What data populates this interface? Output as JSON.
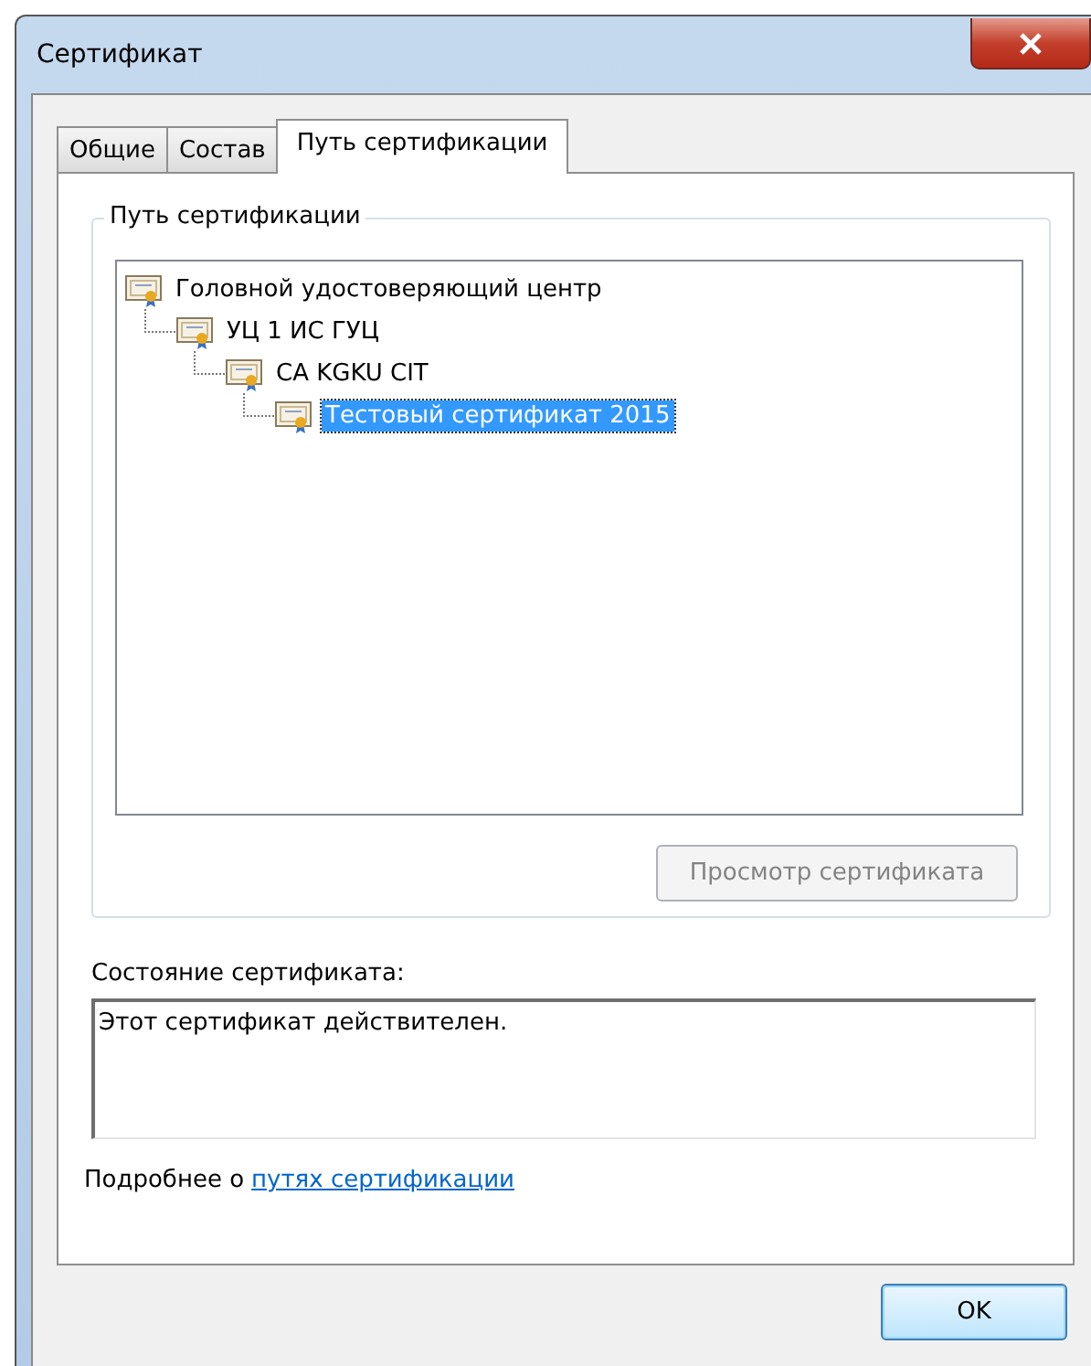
{
  "window": {
    "title": "Сертификат"
  },
  "tabs": [
    {
      "label": "Общие",
      "selected": false
    },
    {
      "label": "Состав",
      "selected": false
    },
    {
      "label": "Путь сертификации",
      "selected": true
    }
  ],
  "path_group": {
    "title": "Путь сертификации",
    "tree": [
      {
        "label": "Головной удостоверяющий центр",
        "selected": false,
        "children": [
          {
            "label": "УЦ 1 ИС ГУЦ",
            "selected": false,
            "children": [
              {
                "label": "CA KGKU CIT",
                "selected": false,
                "children": [
                  {
                    "label": "Тестовый сертификат 2015",
                    "selected": true
                  }
                ]
              }
            ]
          }
        ]
      }
    ],
    "view_button": {
      "label": "Просмотр сертификата",
      "disabled": true
    }
  },
  "status": {
    "label": "Состояние сертификата:",
    "value": "Этот сертификат действителен."
  },
  "more_info": {
    "text": "Подробнее о",
    "link": "путях сертификации"
  },
  "buttons": [
    {
      "label": "OK"
    }
  ]
}
